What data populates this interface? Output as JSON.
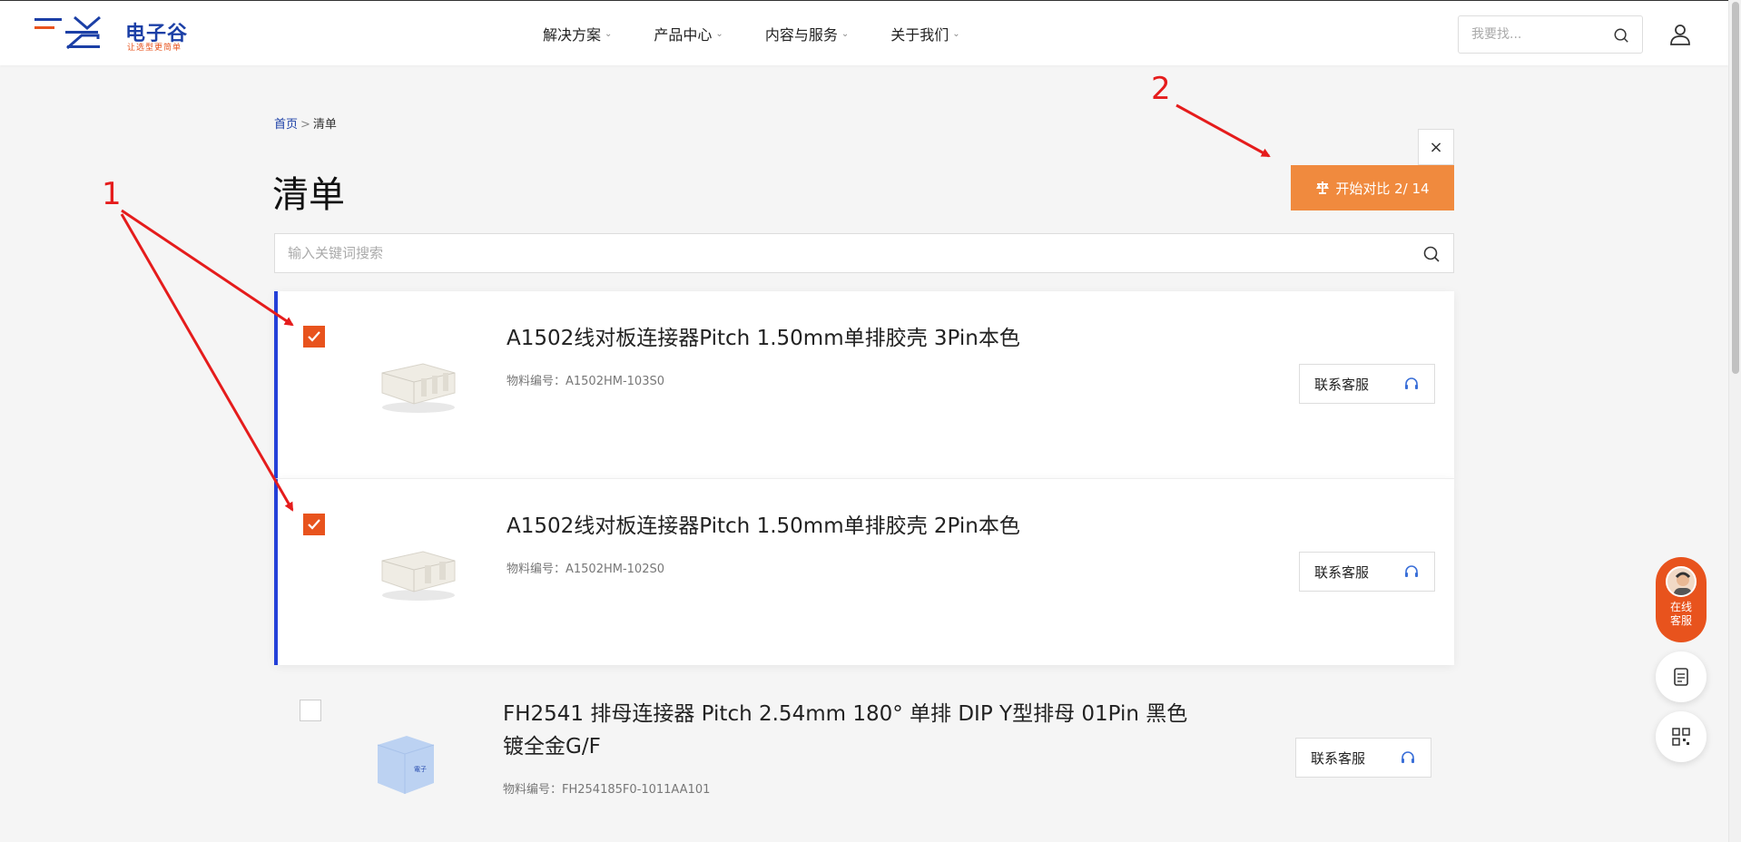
{
  "header": {
    "logo_title": "电子谷",
    "logo_subtitle": "让选型更简单",
    "nav": [
      {
        "label": "解决方案"
      },
      {
        "label": "产品中心"
      },
      {
        "label": "内容与服务"
      },
      {
        "label": "关于我们"
      }
    ],
    "search_placeholder": "我要找..."
  },
  "breadcrumb": {
    "home": "首页",
    "separator": ">",
    "current": "清单"
  },
  "page_title": "清单",
  "close_label": "×",
  "compare_button": {
    "label": "开始对比 2/ 14"
  },
  "list_search_placeholder": "输入关键词搜索",
  "items": [
    {
      "name": "A1502线对板连接器Pitch 1.50mm单排胶壳 3Pin本色",
      "code": "物料编号：A1502HM-103S0",
      "checked": true,
      "contact_label": "联系客服"
    },
    {
      "name": "A1502线对板连接器Pitch 1.50mm单排胶壳 2Pin本色",
      "code": "物料编号：A1502HM-102S0",
      "checked": true,
      "contact_label": "联系客服"
    },
    {
      "name": "FH2541 排母连接器 Pitch 2.54mm 180° 单排 DIP Y型排母 01Pin 黑色 镀全金G/F",
      "code": "物料编号：FH254185F0-1011AA101",
      "checked": false,
      "contact_label": "联系客服"
    }
  ],
  "float": {
    "online_service": "在线\n客服"
  },
  "annotations": {
    "label_1": "1",
    "label_2": "2"
  },
  "colors": {
    "brand_blue": "#1b3fa6",
    "brand_orange": "#e8531d",
    "compare_orange": "#f08a3e",
    "selected_border": "#2340d8",
    "annotation_red": "#e51c1c"
  },
  "icons": [
    "search-icon",
    "user-icon",
    "check-icon",
    "headset-icon",
    "document-icon",
    "qrcode-icon"
  ]
}
